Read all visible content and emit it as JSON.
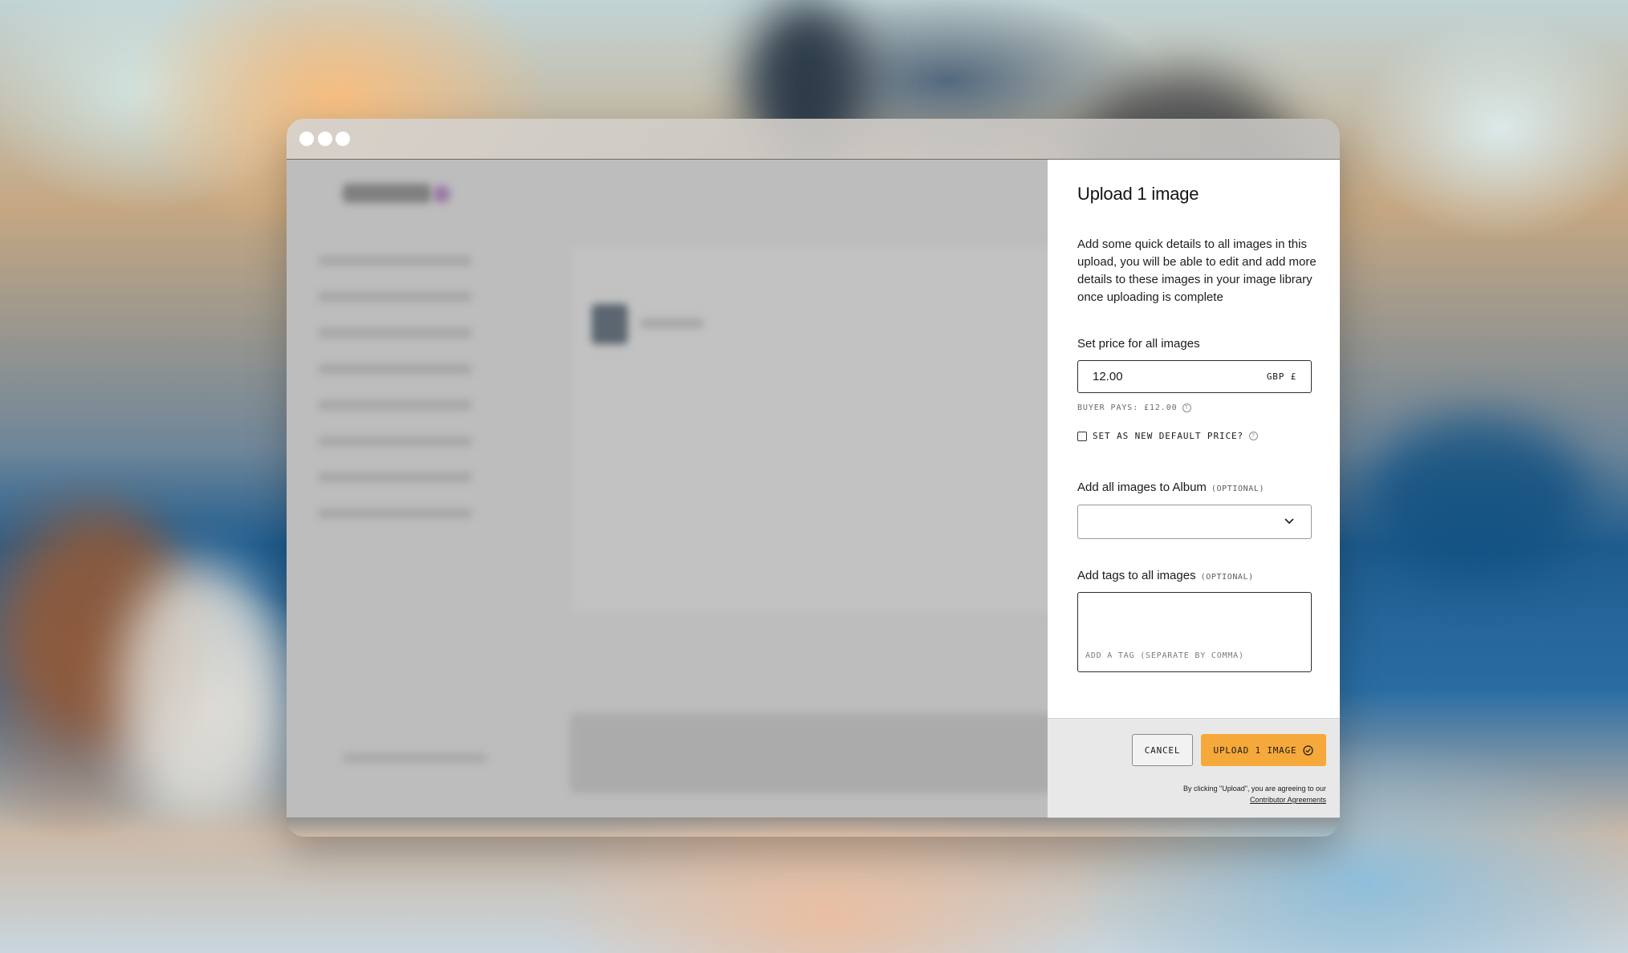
{
  "panel": {
    "title": "Upload 1 image",
    "description": "Add some quick details to all images in this upload, you will be able to edit and add more details to these images in your image library once uploading is complete",
    "price": {
      "label": "Set price for all images",
      "value": "12.00",
      "currency": "GBP £",
      "buyer_pays": "BUYER PAYS: £12.00",
      "info_icon": "info-icon"
    },
    "default_price": {
      "label": "SET AS NEW DEFAULT PRICE?",
      "checked": false
    },
    "album": {
      "label": "Add all images to Album",
      "optional": "(OPTIONAL)",
      "selected": "",
      "icon": "chevron-down-icon"
    },
    "tags": {
      "label": "Add tags to all images",
      "optional": "(OPTIONAL)",
      "placeholder": "ADD A TAG (SEPARATE BY COMMA)"
    },
    "footer": {
      "cancel_label": "CANCEL",
      "upload_label": "UPLOAD 1 IMAGE",
      "upload_icon": "check-circle-icon",
      "agreement_text": "By clicking \"Upload\", you are agreeing to our",
      "agreement_link": "Contributor Agreements"
    }
  },
  "colors": {
    "accent": "#f5a93a",
    "panel_bg": "#ffffff",
    "footer_bg": "#e8e8e8",
    "dimmed_app": "#bdbdbd"
  }
}
